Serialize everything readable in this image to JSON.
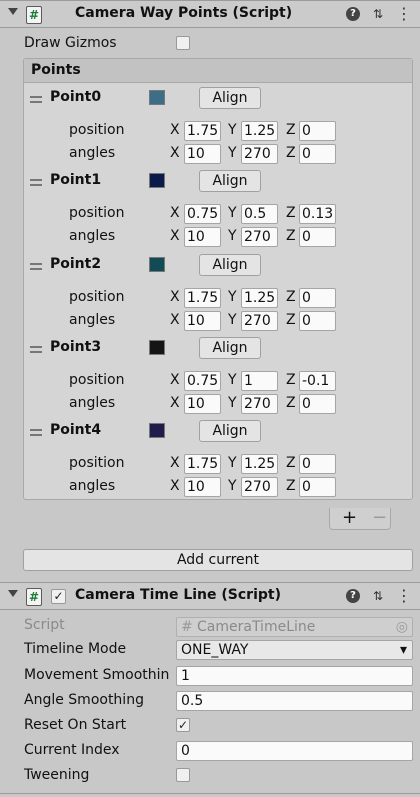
{
  "components": [
    {
      "title": "Camera Way Points (Script)",
      "draw_gizmos_label": "Draw Gizmos",
      "points_header": "Points",
      "points": [
        {
          "name": "Point0",
          "color": "#3c6e87",
          "align": "Align",
          "position": {
            "x": "1.75",
            "y": "1.25",
            "z": "0"
          },
          "angles": {
            "x": "10",
            "y": "270",
            "z": "0"
          }
        },
        {
          "name": "Point1",
          "color": "#0a1a4a",
          "align": "Align",
          "position": {
            "x": "0.75",
            "y": "0.5",
            "z": "0.13"
          },
          "angles": {
            "x": "10",
            "y": "270",
            "z": "0"
          }
        },
        {
          "name": "Point2",
          "color": "#124a56",
          "align": "Align",
          "position": {
            "x": "1.75",
            "y": "1.25",
            "z": "0"
          },
          "angles": {
            "x": "10",
            "y": "270",
            "z": "0"
          }
        },
        {
          "name": "Point3",
          "color": "#151515",
          "align": "Align",
          "position": {
            "x": "0.75",
            "y": "1",
            "z": "-0.1"
          },
          "angles": {
            "x": "10",
            "y": "270",
            "z": "0"
          }
        },
        {
          "name": "Point4",
          "color": "#201c4c",
          "align": "Align",
          "position": {
            "x": "1.75",
            "y": "1.25",
            "z": "0"
          },
          "angles": {
            "x": "10",
            "y": "270",
            "z": "0"
          }
        }
      ],
      "labels": {
        "position": "position",
        "angles": "angles",
        "x": "X",
        "y": "Y",
        "z": "Z"
      },
      "plus": "+",
      "minus": "−",
      "add_current": "Add current"
    },
    {
      "title": "Camera Time Line (Script)",
      "enabled_check": "✓",
      "rows": {
        "script_label": "Script",
        "script_value": "CameraTimeLine",
        "timeline_mode_label": "Timeline Mode",
        "timeline_mode_value": "ONE_WAY",
        "movement_label": "Movement Smoothin",
        "movement_value": "1",
        "angle_label": "Angle Smoothing",
        "angle_value": "0.5",
        "reset_label": "Reset On Start",
        "reset_check": "✓",
        "index_label": "Current Index",
        "index_value": "0",
        "tweening_label": "Tweening"
      }
    }
  ],
  "icons": {
    "script": "#",
    "help": "?",
    "presets": "⇅",
    "menu": "⋮",
    "chevron": "▾",
    "target": "◎"
  }
}
